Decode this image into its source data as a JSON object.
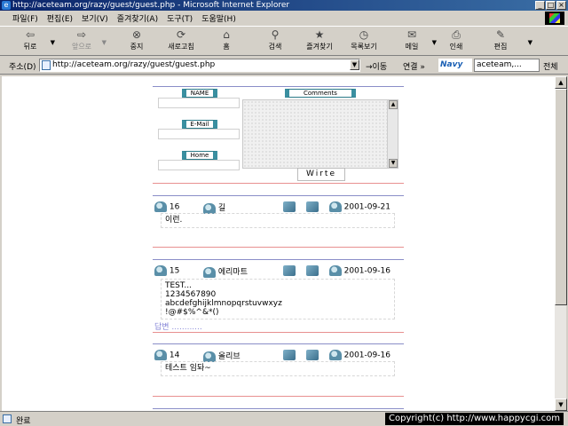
{
  "window": {
    "title": "http://aceteam.org/razy/guest/guest.php - Microsoft Internet Explorer",
    "buttons": [
      "_",
      "□",
      "×"
    ]
  },
  "menu": [
    "파일(F)",
    "편집(E)",
    "보기(V)",
    "즐겨찾기(A)",
    "도구(T)",
    "도움말(H)"
  ],
  "toolbar": {
    "back": "뒤로",
    "forward": "앞으로",
    "stop": "중지",
    "refresh": "새로고침",
    "home": "홈",
    "search": "검색",
    "favorites": "즐겨찾기",
    "history": "목록보기",
    "mail": "메일",
    "print": "인쇄",
    "edit": "편집"
  },
  "address": {
    "label": "주소(D)",
    "url": "http://aceteam.org/razy/guest/guest.php",
    "go": "이동",
    "links": "연결 »",
    "navy": "Navy",
    "navy_input": "aceteam,...",
    "navy_all": "전체"
  },
  "form": {
    "name_label": "NAME",
    "comments_label": "Comments",
    "email_label": "E-Mail",
    "home_label": "Home",
    "write_button": "Wirte"
  },
  "entries": [
    {
      "num": "16",
      "author": "길",
      "date": "2001-09-21",
      "message": "이런."
    },
    {
      "num": "15",
      "author": "에리마트",
      "date": "2001-09-16",
      "message": "TEST...\n1234567890\nabcdefghijklmnopqrstuvwxyz\n!@#$%^&*()",
      "reply": "답변 ............"
    },
    {
      "num": "14",
      "author": "올리브",
      "date": "2001-09-16",
      "message": "테스트 임돠~"
    }
  ],
  "status": {
    "text": "완료",
    "copyright": "Copyright(c) http://www.happycgi.com"
  }
}
